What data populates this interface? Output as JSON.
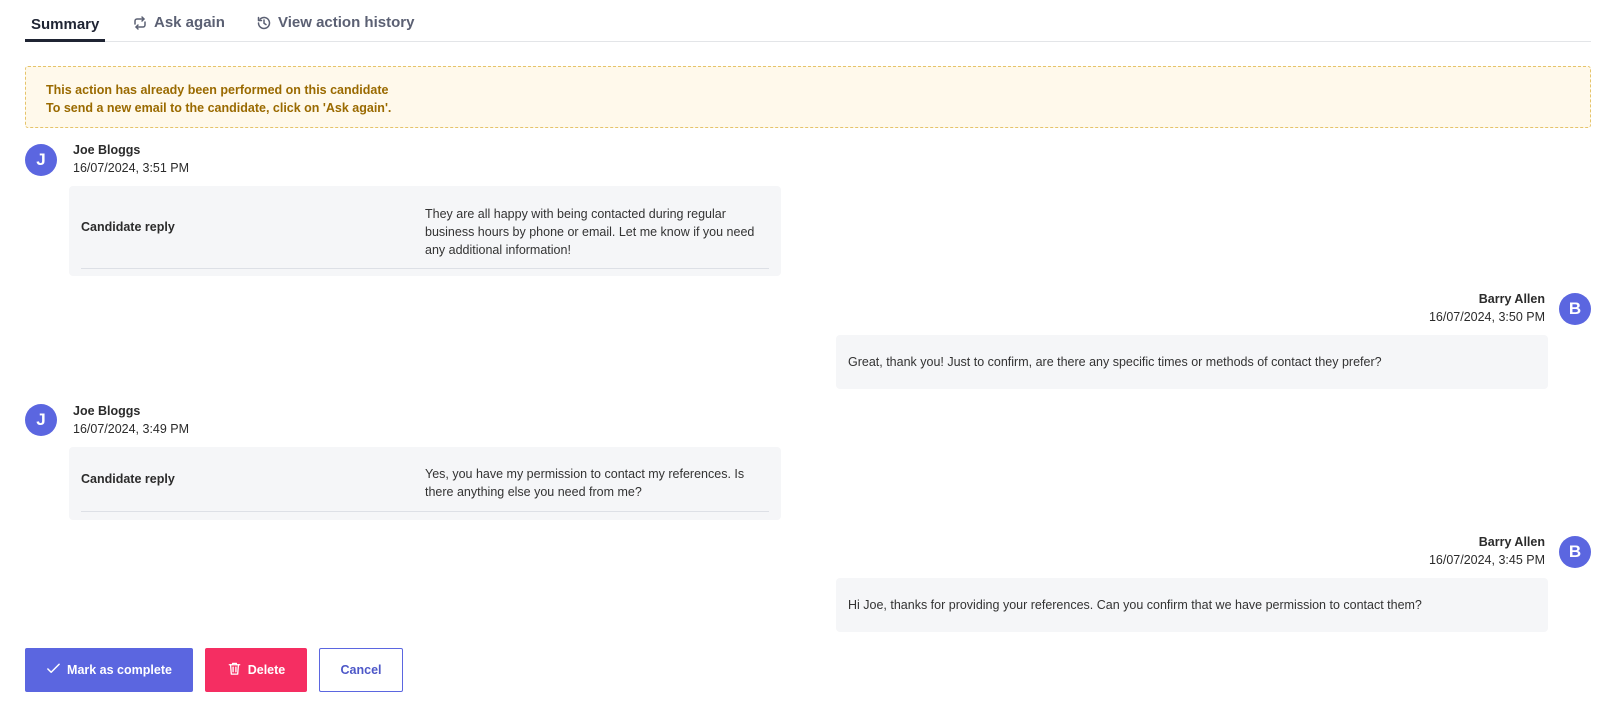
{
  "tabs": [
    {
      "label": "Summary",
      "icon": "none",
      "active": true
    },
    {
      "label": "Ask again",
      "icon": "refresh-icon",
      "active": false
    },
    {
      "label": "View action history",
      "icon": "history-icon",
      "active": false
    }
  ],
  "notice": {
    "line1": "This action has already been performed on this candidate",
    "line2": "To send a new email to the candidate, click on 'Ask again'."
  },
  "messages": [
    {
      "initial": "J",
      "author": "Joe Bloggs",
      "time": "16/07/2024, 3:51 PM",
      "reply_label": "Candidate reply",
      "text": "They are all happy with being contacted during regular business hours by phone or email. Let me know if you need any additional information!"
    },
    {
      "initial": "B",
      "author": "Barry Allen",
      "time": "16/07/2024, 3:50 PM",
      "text": "Great, thank you! Just to confirm, are there any specific times or methods of contact they prefer?"
    },
    {
      "initial": "J",
      "author": "Joe Bloggs",
      "time": "16/07/2024, 3:49 PM",
      "reply_label": "Candidate reply",
      "text": "Yes, you have my permission to contact my references. Is there anything else you need from me?"
    },
    {
      "initial": "B",
      "author": "Barry Allen",
      "time": "16/07/2024, 3:45 PM",
      "text": "Hi Joe, thanks for providing your references. Can you confirm that we have permission to contact them?"
    }
  ],
  "buttons": {
    "complete": "Mark as complete",
    "delete": "Delete",
    "cancel": "Cancel"
  },
  "colors": {
    "accent": "#5b66e0",
    "danger": "#f52e62",
    "notice_bg": "#fff9eb",
    "notice_text": "#9a6a00"
  }
}
